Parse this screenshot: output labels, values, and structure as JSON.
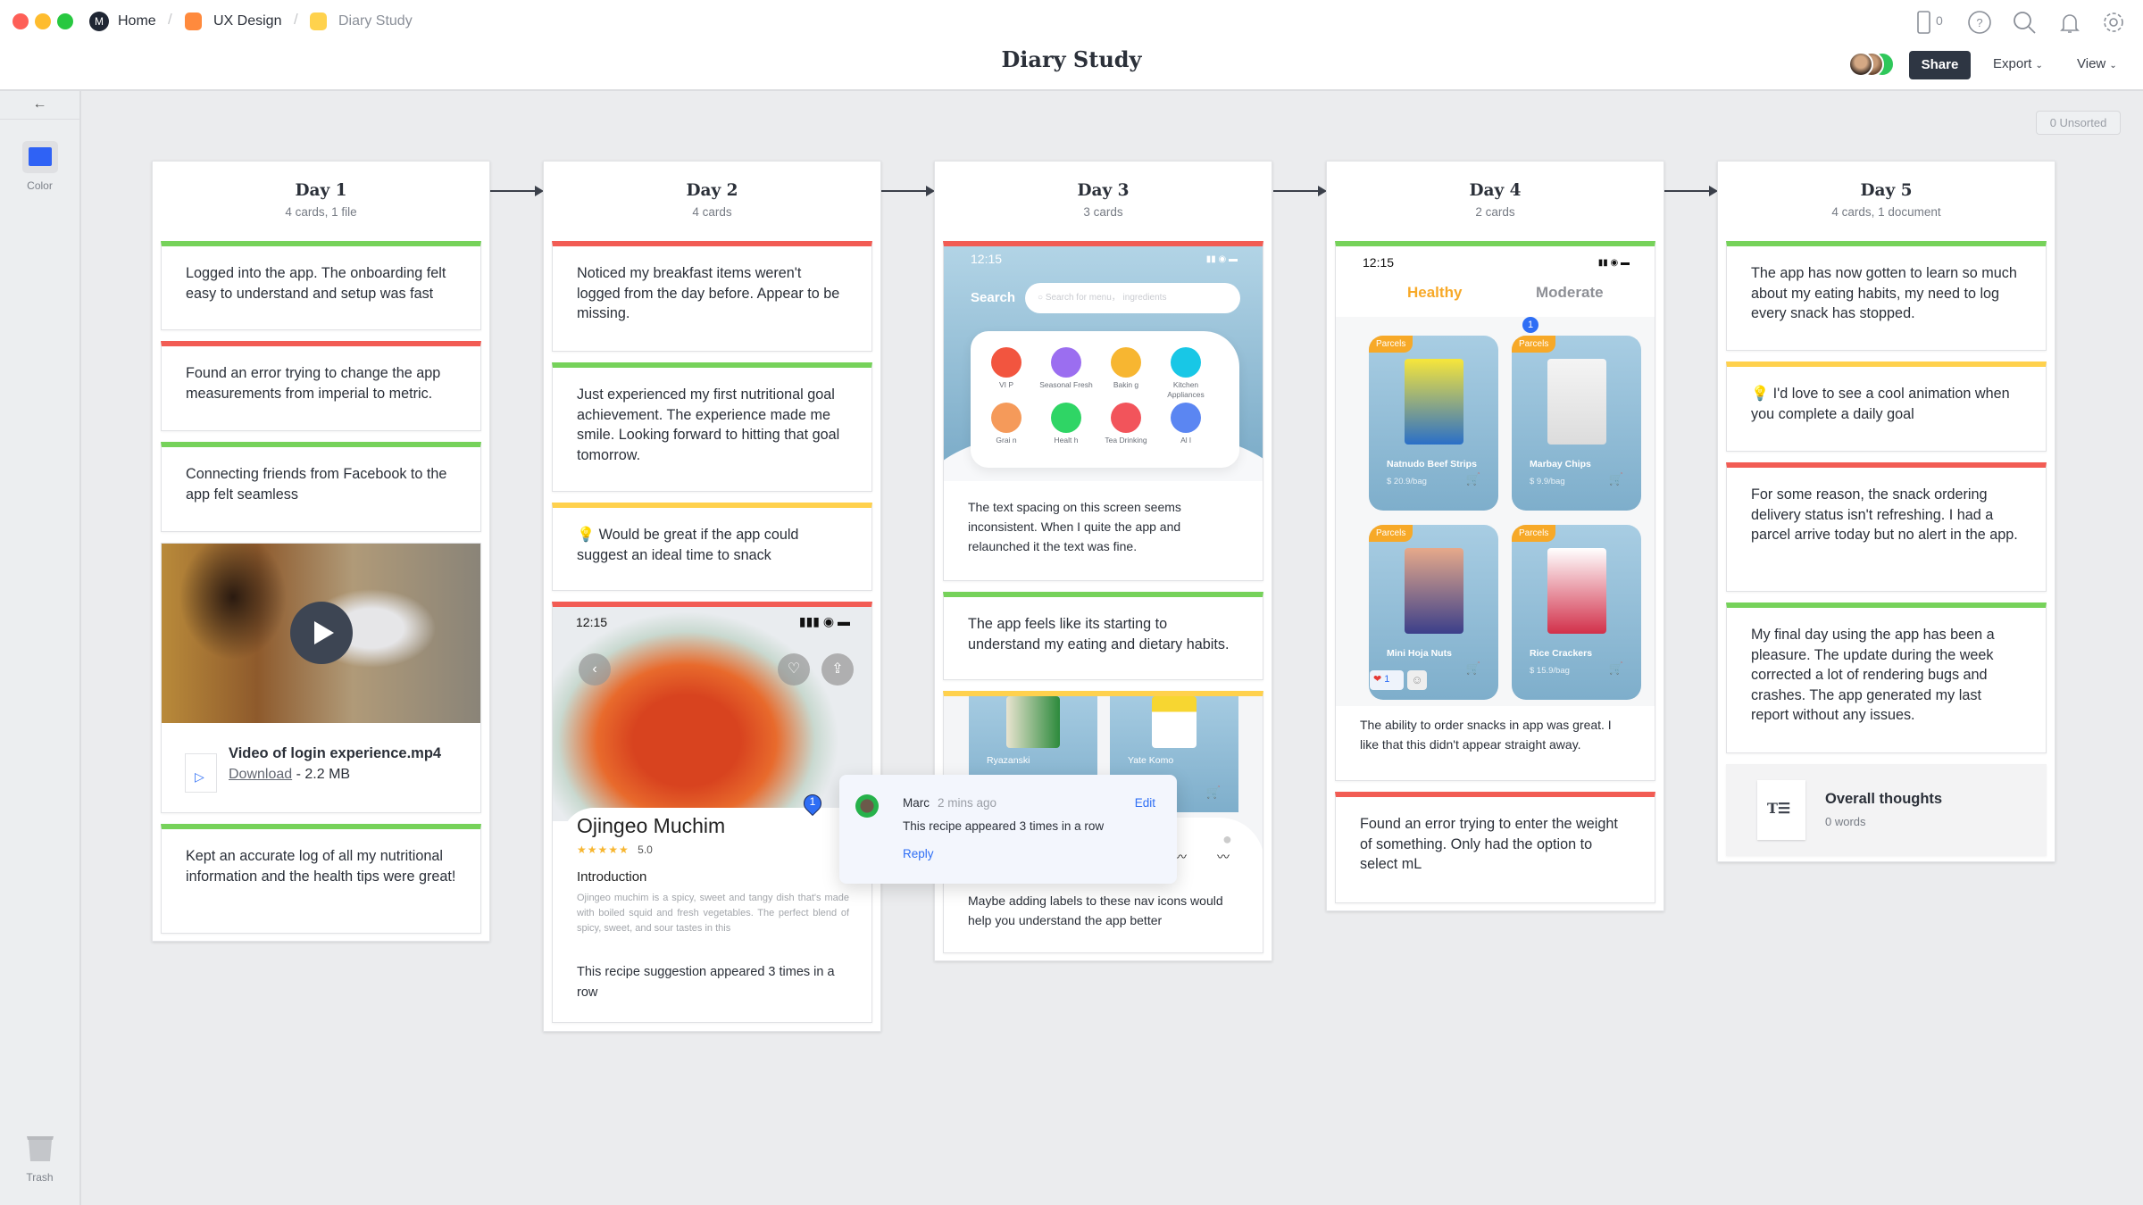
{
  "window": {
    "controls": [
      "close",
      "minimize",
      "maximize"
    ]
  },
  "breadcrumb": {
    "items": [
      {
        "label": "Home",
        "color": "#1f2633",
        "icon": "milanote-logo-icon"
      },
      {
        "label": "UX Design",
        "color": "#ff8a3d"
      },
      {
        "label": "Diary Study",
        "color": "#ffd24d"
      }
    ]
  },
  "header": {
    "title": "Diary Study",
    "device_count": "0",
    "share": "Share",
    "export": "Export",
    "view": "View",
    "icons": [
      "mobile-icon",
      "help-icon",
      "search-icon",
      "bell-icon",
      "gear-icon"
    ]
  },
  "unsorted": "0 Unsorted",
  "sidebar": {
    "back_icon": "arrow-left-icon",
    "color_label": "Color",
    "color_swatch": "#2f62f5",
    "trash_label": "Trash"
  },
  "colors": {
    "green": "#76d25a",
    "red": "#f25c54",
    "yellow": "#ffd14d",
    "accent": "#2e6ef5"
  },
  "columns": [
    {
      "title": "Day 1",
      "subtitle": "4 cards, 1 file",
      "cards": [
        {
          "text": "Logged into the app. The onboarding felt easy to understand and setup was fast",
          "status": "green"
        },
        {
          "text": "Found an error trying to change the app measurements from imperial to metric.",
          "status": "red"
        },
        {
          "text": "Connecting friends from Facebook to the app felt seamless",
          "status": "green"
        },
        {
          "file_name": "Video of login experience.mp4",
          "download": "Download",
          "size": "- 2.2 MB"
        },
        {
          "text": "Kept an accurate log of all my nutritional information and the health tips were great!",
          "status": "green"
        }
      ]
    },
    {
      "title": "Day 2",
      "subtitle": "4 cards",
      "cards": [
        {
          "text": "Noticed my breakfast items weren't logged from the day before. Appear to be missing.",
          "status": "red"
        },
        {
          "text": "Just experienced my first nutritional goal achievement. The experience made me smile. Looking forward to hitting that goal tomorrow.",
          "status": "green"
        },
        {
          "text": "💡 Would be great if the app could suggest an ideal time to snack",
          "status": "yellow"
        },
        {
          "status": "red",
          "phone": {
            "time": "12:15",
            "dish": "Ojingeo Muchim",
            "stars": "★★★★★",
            "rating": "5.0",
            "intro_heading": "Introduction",
            "intro": "Ojingeo muchim is a spicy, sweet and tangy dish that's made with boiled squid and fresh vegetables. The perfect blend of spicy, sweet, and sour tastes in this"
          },
          "text": "This recipe suggestion appeared 3 times in a row"
        }
      ]
    },
    {
      "title": "Day 3",
      "subtitle": "3 cards",
      "cards": [
        {
          "status": "red",
          "phone": {
            "time": "12:15",
            "search_label": "Search",
            "search_placeholder": "Search for menu， ingredients",
            "categories": [
              {
                "label": "VI P",
                "color": "#f2553f"
              },
              {
                "label": "Seasonal Fresh",
                "color": "#9b6ef0"
              },
              {
                "label": "Bakin g",
                "color": "#f7b631"
              },
              {
                "label": "Kitchen Appliances",
                "color": "#18c7e6"
              },
              {
                "label": "Grai n",
                "color": "#f59a5a"
              },
              {
                "label": "Healt h",
                "color": "#2fd565"
              },
              {
                "label": "Tea Drinking",
                "color": "#f2545b"
              },
              {
                "label": "Al l",
                "color": "#5b86f2"
              }
            ]
          },
          "text": "The text spacing on this screen seems inconsistent. When I quite the app and relaunched it the text was fine."
        },
        {
          "text": "The app feels like its starting to understand my eating and dietary habits.",
          "status": "green"
        },
        {
          "status": "yellow",
          "products": [
            "Ryazanski",
            "Yate Komo"
          ],
          "text": "Maybe adding labels to these nav icons would help you understand the app better"
        }
      ]
    },
    {
      "title": "Day 4",
      "subtitle": "2 cards",
      "cards": [
        {
          "status": "green",
          "phone": {
            "time": "12:15",
            "tab_active": "Healthy",
            "tab_other": "Moderate",
            "badge": "Parcels",
            "products": [
              {
                "name": "Natnudo Beef Strips",
                "price": "$ 20.9/bag"
              },
              {
                "name": "Marbay Chips",
                "price": "$ 9.9/bag"
              },
              {
                "name": "Mini Hoja Nuts",
                "price": ""
              },
              {
                "name": "Rice Crackers",
                "price": "$ 15.9/bag"
              }
            ],
            "comment_pin": "1",
            "reaction_count": "1"
          },
          "text": "The ability to order snacks in app was great. I like that this didn't appear straight away."
        },
        {
          "text": "Found an error trying to enter the weight of something. Only had the option to select mL",
          "status": "red"
        }
      ]
    },
    {
      "title": "Day 5",
      "subtitle": "4 cards, 1 document",
      "cards": [
        {
          "text": "The app has now gotten to learn so much about my eating habits, my need to log every snack has stopped.",
          "status": "green"
        },
        {
          "text": "💡 I'd love to see a cool animation when you complete a daily goal",
          "status": "yellow"
        },
        {
          "text": "For some reason, the snack ordering delivery status isn't refreshing. I had a parcel arrive today but no alert in the app.",
          "status": "red"
        },
        {
          "text": "My final day using the app has been a pleasure. The update during the week corrected a lot of rendering bugs and crashes. The app generated my last report without any issues.",
          "status": "green"
        },
        {
          "doc_title": "Overall thoughts",
          "doc_meta": "0 words"
        }
      ]
    }
  ],
  "comment": {
    "pin": "1",
    "author": "Marc",
    "time": "2 mins ago",
    "edit": "Edit",
    "body": "This recipe appeared 3 times in a row",
    "reply": "Reply"
  }
}
